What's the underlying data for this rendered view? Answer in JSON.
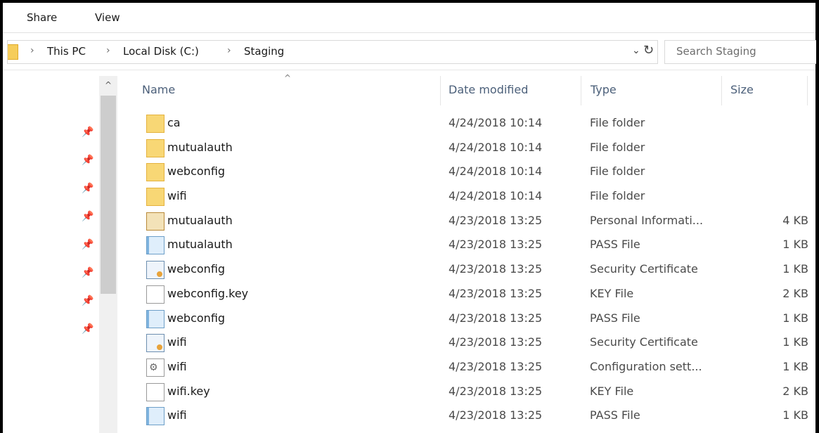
{
  "ribbon": {
    "tabs": [
      "Share",
      "View"
    ]
  },
  "address": {
    "crumbs": [
      "This PC",
      "Local Disk (C:)",
      "Staging"
    ],
    "separator": "›",
    "dropdown_glyph": "⌄",
    "refresh_glyph": "↻"
  },
  "search": {
    "placeholder": "Search Staging"
  },
  "columns": {
    "name": "Name",
    "date": "Date modified",
    "type": "Type",
    "size": "Size",
    "sort_glyph": "^"
  },
  "nav": {
    "pin_glyph": "📌",
    "scroll_up": "^"
  },
  "files": [
    {
      "name": "ca",
      "date": "4/24/2018 10:14",
      "type": "File folder",
      "size": "",
      "icon": "folder-icon"
    },
    {
      "name": "mutualauth",
      "date": "4/24/2018 10:14",
      "type": "File folder",
      "size": "",
      "icon": "folder-icon"
    },
    {
      "name": "webconfig",
      "date": "4/24/2018 10:14",
      "type": "File folder",
      "size": "",
      "icon": "folder-icon"
    },
    {
      "name": "wifi",
      "date": "4/24/2018 10:14",
      "type": "File folder",
      "size": "",
      "icon": "folder-icon"
    },
    {
      "name": "mutualauth",
      "date": "4/23/2018 13:25",
      "type": "Personal Informati...",
      "size": "4 KB",
      "icon": "pfx-icon"
    },
    {
      "name": "mutualauth",
      "date": "4/23/2018 13:25",
      "type": "PASS File",
      "size": "1 KB",
      "icon": "pass-file-icon"
    },
    {
      "name": "webconfig",
      "date": "4/23/2018 13:25",
      "type": "Security Certificate",
      "size": "1 KB",
      "icon": "certificate-icon"
    },
    {
      "name": "webconfig.key",
      "date": "4/23/2018 13:25",
      "type": "KEY File",
      "size": "2 KB",
      "icon": "key-file-icon"
    },
    {
      "name": "webconfig",
      "date": "4/23/2018 13:25",
      "type": "PASS File",
      "size": "1 KB",
      "icon": "pass-file-icon"
    },
    {
      "name": "wifi",
      "date": "4/23/2018 13:25",
      "type": "Security Certificate",
      "size": "1 KB",
      "icon": "certificate-icon"
    },
    {
      "name": "wifi",
      "date": "4/23/2018 13:25",
      "type": "Configuration sett...",
      "size": "1 KB",
      "icon": "config-file-icon"
    },
    {
      "name": "wifi.key",
      "date": "4/23/2018 13:25",
      "type": "KEY File",
      "size": "2 KB",
      "icon": "key-file-icon"
    },
    {
      "name": "wifi",
      "date": "4/23/2018 13:25",
      "type": "PASS File",
      "size": "1 KB",
      "icon": "pass-file-icon"
    }
  ]
}
